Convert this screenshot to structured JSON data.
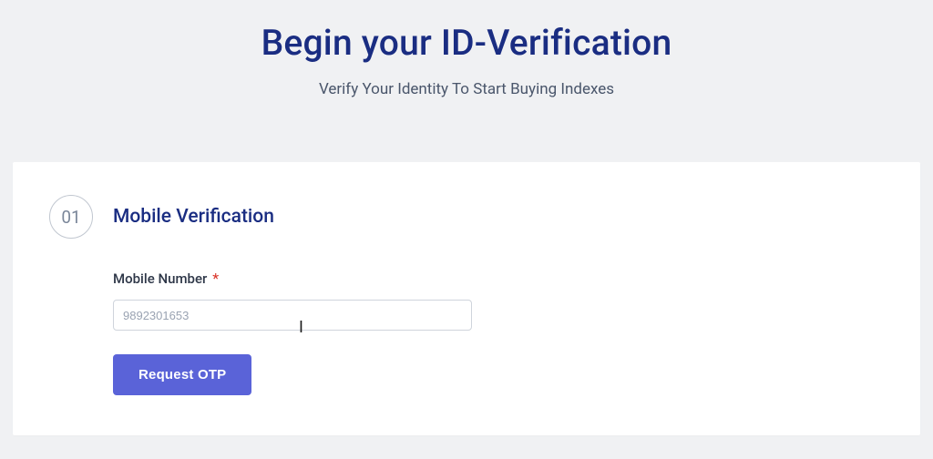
{
  "header": {
    "title": "Begin your ID-Verification",
    "subtitle": "Verify Your Identity To Start Buying Indexes"
  },
  "step": {
    "number": "01",
    "title": "Mobile Verification"
  },
  "form": {
    "mobile_label": "Mobile Number",
    "required_mark": "*",
    "mobile_placeholder": "9892301653",
    "mobile_value": "",
    "request_otp_label": "Request OTP"
  }
}
